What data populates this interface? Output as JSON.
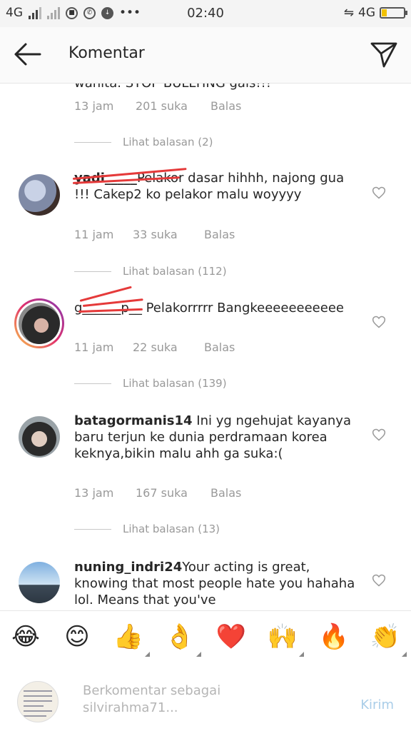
{
  "statusbar": {
    "network1": "4G",
    "time": "02:40",
    "network2": "4G",
    "battery_level": 0.22
  },
  "header": {
    "title": "Komentar"
  },
  "comments": [
    {
      "username": "",
      "text": "wanita. STOP BULLYING gais!!!",
      "time": "13 jam",
      "likes": "201 suka",
      "reply": "Balas",
      "view_replies": "Lihat balasan (2)"
    },
    {
      "username": "yadi_____",
      "text": "Pelakor dasar hihhh, najong gua !!! Cakep2 ko pelakor malu woyyyy",
      "time": "11 jam",
      "likes": "33 suka",
      "reply": "Balas",
      "view_replies": "Lihat balasan (112)"
    },
    {
      "username": "g______p__",
      "text": "Pelakorrrrr Bangkeeeeeeeeeee",
      "time": "11 jam",
      "likes": "22 suka",
      "reply": "Balas",
      "view_replies": "Lihat balasan (139)"
    },
    {
      "username": "batagormanis14",
      "text": "Ini yg ngehujat kayanya baru terjun ke dunia perdramaan korea keknya,bikin malu ahh ga suka:(",
      "time": "13 jam",
      "likes": "167 suka",
      "reply": "Balas",
      "view_replies": "Lihat balasan (13)"
    },
    {
      "username": "nuning_indri24",
      "text": "Your acting is great, knowing that most people hate you hahaha lol. Means that you've"
    }
  ],
  "emojis": [
    {
      "name": "face-with-tears-of-joy",
      "glyph": "😂"
    },
    {
      "name": "smiling-face",
      "glyph": "😊"
    },
    {
      "name": "thumbs-up",
      "glyph": "👍"
    },
    {
      "name": "ok-hand",
      "glyph": "👌"
    },
    {
      "name": "red-heart",
      "glyph": "❤️"
    },
    {
      "name": "raising-hands",
      "glyph": "🙌"
    },
    {
      "name": "fire",
      "glyph": "🔥"
    },
    {
      "name": "clapping-hands",
      "glyph": "👏"
    }
  ],
  "composer": {
    "placeholder": "Berkomentar sebagai silvirahma71...",
    "send_label": "Kirim"
  }
}
